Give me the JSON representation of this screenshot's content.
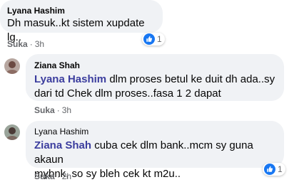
{
  "comments": [
    {
      "author": "Lyana Hashim",
      "text": "Dh masuk..kt sistem xupdate lg..",
      "like_label": "Suka",
      "separator": "·",
      "time": "3h",
      "reaction_count": "1"
    },
    {
      "author": "Ziana Shah",
      "mention": "Lyana Hashim",
      "text_line1": " dlm proses betul ke duit dh ada..sy",
      "text_line2": "dari td Chek dlm proses..fasa 1 2 dapat",
      "like_label": "Suka",
      "separator": "·",
      "time": "3h"
    },
    {
      "author": "Lyana Hashim",
      "mention": "Ziana Shah",
      "text_line1": " cuba cek dlm bank..mcm sy guna akaun",
      "text_line2": "mybnk, so sy bleh cek kt m2u..",
      "like_label": "Suka",
      "separator": "·",
      "time": "2h",
      "reaction_count": "1"
    }
  ],
  "colors": {
    "bubble": "#f0f2f5",
    "mention": "#3b3d9e",
    "meta": "#65676b",
    "like_blue": "#1877f2"
  },
  "icons": {
    "reaction": "thumbs-up-icon"
  }
}
